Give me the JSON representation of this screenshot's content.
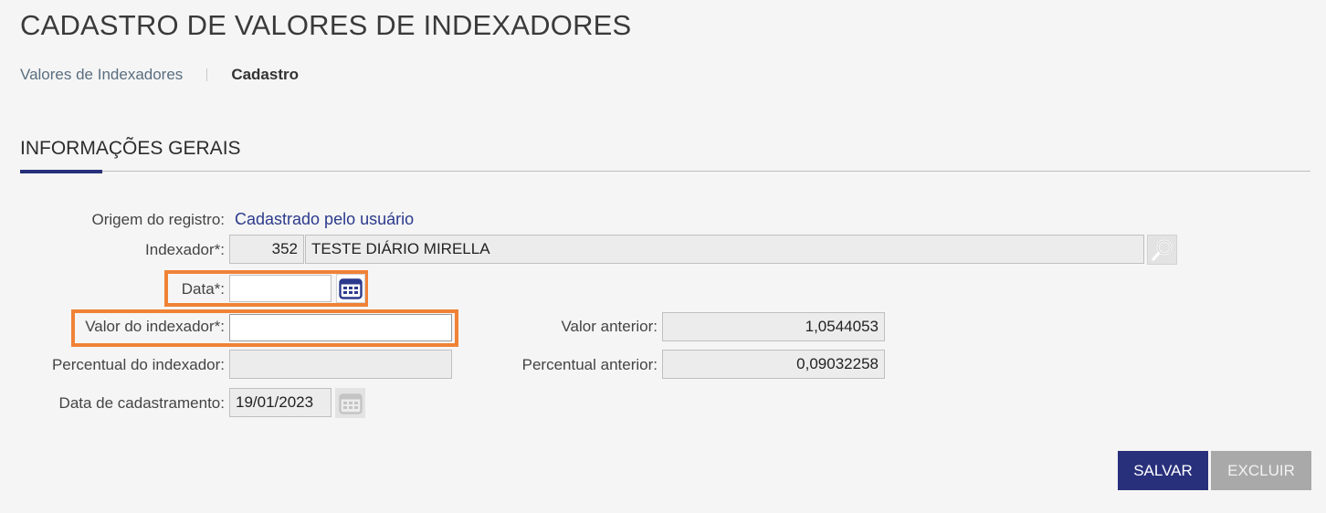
{
  "page": {
    "title": "CADASTRO DE VALORES DE INDEXADORES",
    "breadcrumb": {
      "link": "Valores de Indexadores",
      "current": "Cadastro"
    }
  },
  "section": {
    "title": "INFORMAÇÕES GERAIS"
  },
  "form": {
    "origem": {
      "label": "Origem do registro:",
      "value": "Cadastrado pelo usuário"
    },
    "indexador": {
      "label": "Indexador*:",
      "code": "352",
      "name": "TESTE DIÁRIO MIRELLA"
    },
    "data": {
      "label": "Data*:",
      "value": ""
    },
    "valor_indexador": {
      "label": "Valor do indexador*:",
      "value": ""
    },
    "percentual_indexador": {
      "label": "Percentual do indexador:",
      "value": ""
    },
    "data_cadastramento": {
      "label": "Data de cadastramento:",
      "value": "19/01/2023"
    },
    "valor_anterior": {
      "label": "Valor anterior:",
      "value": "1,0544053"
    },
    "percentual_anterior": {
      "label": "Percentual anterior:",
      "value": "0,09032258"
    }
  },
  "actions": {
    "save": "SALVAR",
    "delete": "EXCLUIR"
  },
  "colors": {
    "primary": "#28307c",
    "highlight": "#f08236",
    "disabled": "#a9a9a9"
  },
  "icons": {
    "search": "magnifier-icon",
    "calendar": "calendar-icon"
  }
}
